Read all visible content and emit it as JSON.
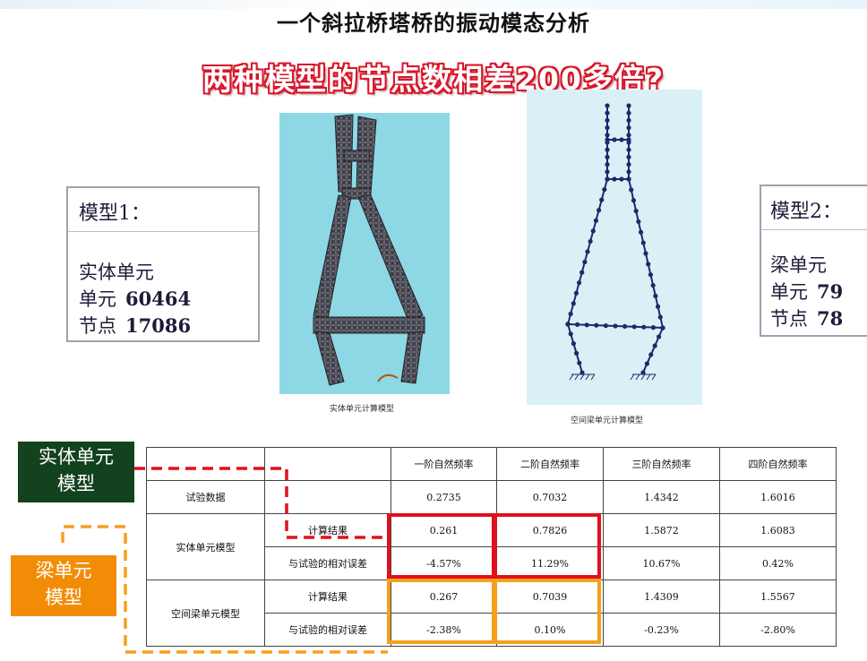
{
  "title": "一个斜拉桥塔桥的振动模态分析",
  "question": "两种模型的节点数相差200多倍?",
  "model1": {
    "title": "模型1：",
    "type": "实体单元",
    "elements_label": "单元",
    "elements": "60464",
    "nodes_label": "节点",
    "nodes": "17086",
    "caption": "实体单元计算模型"
  },
  "model2": {
    "title": "模型2：",
    "type": "梁单元",
    "elements_label": "单元",
    "elements": "79",
    "nodes_label": "节点",
    "nodes": "78",
    "caption": "空间梁单元计算模型"
  },
  "tags": {
    "solid_line1": "实体单元",
    "solid_line2": "模型",
    "beam_line1": "梁单元",
    "beam_line2": "模型"
  },
  "colors": {
    "question_red": "#d8162a",
    "solid_tag_green": "#13421e",
    "beam_tag_orange": "#f28c06",
    "highlight_red": "#e0101e",
    "highlight_orange": "#f5a01a",
    "tower_solid": "#3a3a46",
    "tower_beam_nodes": "#1a2a6a"
  },
  "table": {
    "headers": [
      "",
      "",
      "一阶自然频率",
      "二阶自然频率",
      "三阶自然频率",
      "四阶自然频率"
    ],
    "test_row": {
      "label": "试验数据",
      "values": [
        "0.2735",
        "0.7032",
        "1.4342",
        "1.6016"
      ]
    },
    "solid": {
      "label": "实体单元模型",
      "calc_label": "计算结果",
      "calc": [
        "0.261",
        "0.7826",
        "1.5872",
        "1.6083"
      ],
      "err_label": "与试验的相对误差",
      "err": [
        "-4.57%",
        "11.29%",
        "10.67%",
        "0.42%"
      ]
    },
    "beam": {
      "label": "空间梁单元模型",
      "calc_label": "计算结果",
      "calc": [
        "0.267",
        "0.7039",
        "1.4309",
        "1.5567"
      ],
      "err_label": "与试验的相对误差",
      "err": [
        "-2.38%",
        "0.10%",
        "-0.23%",
        "-2.80%"
      ]
    }
  }
}
